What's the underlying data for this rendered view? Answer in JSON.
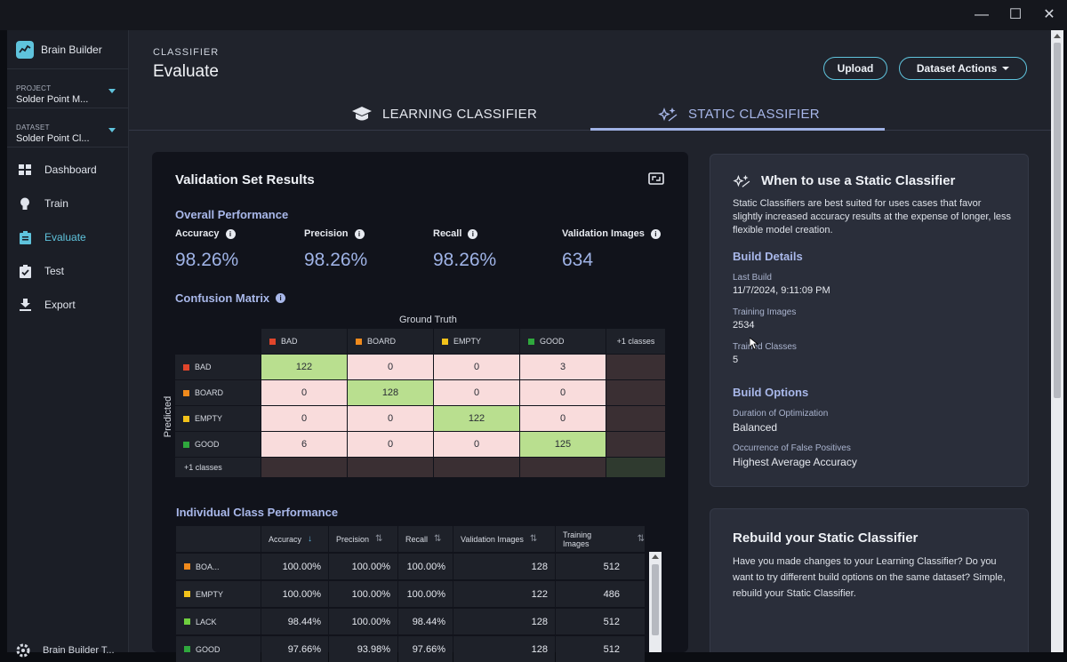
{
  "window": {
    "controls": {
      "minimize": "—",
      "maximize": "☐",
      "close": "✕"
    }
  },
  "sidebar": {
    "app_name": "Brain Builder",
    "project": {
      "label": "PROJECT",
      "value": "Solder Point M..."
    },
    "dataset": {
      "label": "DATASET",
      "value": "Solder Point Cl..."
    },
    "nav": [
      {
        "label": "Dashboard",
        "icon": "dashboard-icon"
      },
      {
        "label": "Train",
        "icon": "lightbulb-icon"
      },
      {
        "label": "Evaluate",
        "icon": "clipboard-icon",
        "active": true
      },
      {
        "label": "Test",
        "icon": "checklist-icon"
      },
      {
        "label": "Export",
        "icon": "download-icon"
      }
    ],
    "footer_label": "Brain Builder T..."
  },
  "header": {
    "kicker": "CLASSIFIER",
    "title": "Evaluate",
    "upload_label": "Upload",
    "dataset_actions_label": "Dataset Actions"
  },
  "tabs": [
    {
      "label": "LEARNING CLASSIFIER",
      "icon": "graduation-cap-icon"
    },
    {
      "label": "STATIC CLASSIFIER",
      "icon": "sparkle-icon",
      "active": true
    }
  ],
  "validation": {
    "title": "Validation Set Results",
    "overall_title": "Overall Performance",
    "metrics": [
      {
        "label": "Accuracy",
        "value": "98.26%"
      },
      {
        "label": "Precision",
        "value": "98.26%"
      },
      {
        "label": "Recall",
        "value": "98.26%"
      },
      {
        "label": "Validation Images",
        "value": "634"
      }
    ],
    "confusion_title": "Confusion Matrix",
    "ground_truth_label": "Ground Truth",
    "predicted_label": "Predicted",
    "classes": [
      {
        "name": "BAD",
        "color": "#e0452b"
      },
      {
        "name": "BOARD",
        "color": "#f08a1c"
      },
      {
        "name": "EMPTY",
        "color": "#f2c21a"
      },
      {
        "name": "GOOD",
        "color": "#2fa83d"
      }
    ],
    "more_classes_label": "+1 classes",
    "matrix": [
      [
        "122",
        "0",
        "0",
        "3"
      ],
      [
        "0",
        "128",
        "0",
        "0"
      ],
      [
        "0",
        "0",
        "122",
        "0"
      ],
      [
        "6",
        "0",
        "0",
        "125"
      ]
    ],
    "individual_title": "Individual Class Performance",
    "table": {
      "headers": [
        "Accuracy",
        "Precision",
        "Recall",
        "Validation Images",
        "Training Images"
      ],
      "rows": [
        {
          "name": "BOA...",
          "color": "#f08a1c",
          "values": [
            "100.00%",
            "100.00%",
            "100.00%",
            "128",
            "512"
          ]
        },
        {
          "name": "EMPTY",
          "color": "#f2c21a",
          "values": [
            "100.00%",
            "100.00%",
            "100.00%",
            "122",
            "486"
          ]
        },
        {
          "name": "LACK",
          "color": "#6fcf3f",
          "values": [
            "98.44%",
            "100.00%",
            "98.44%",
            "128",
            "512"
          ]
        },
        {
          "name": "GOOD",
          "color": "#2fa83d",
          "values": [
            "97.66%",
            "93.98%",
            "97.66%",
            "128",
            "512"
          ]
        }
      ]
    }
  },
  "info_card": {
    "title": "When to use a Static Classifier",
    "description": "Static Classifiers are best suited for uses cases that favor slightly increased accuracy results at the expense of longer, less flexible model creation.",
    "build_details_title": "Build Details",
    "details": [
      {
        "label": "Last Build",
        "value": "11/7/2024, 9:11:09 PM"
      },
      {
        "label": "Training Images",
        "value": "2534"
      },
      {
        "label": "Trained Classes",
        "value": "5"
      }
    ],
    "build_options_title": "Build Options",
    "options": [
      {
        "label": "Duration of Optimization",
        "value": "Balanced"
      },
      {
        "label": "Occurrence of False Positives",
        "value": "Highest Average Accuracy"
      }
    ]
  },
  "rebuild_card": {
    "title": "Rebuild your Static Classifier",
    "description": "Have you made changes to your Learning Classifier? Do you want to try different build options on the same dataset? Simple, rebuild your Static Classifier."
  }
}
